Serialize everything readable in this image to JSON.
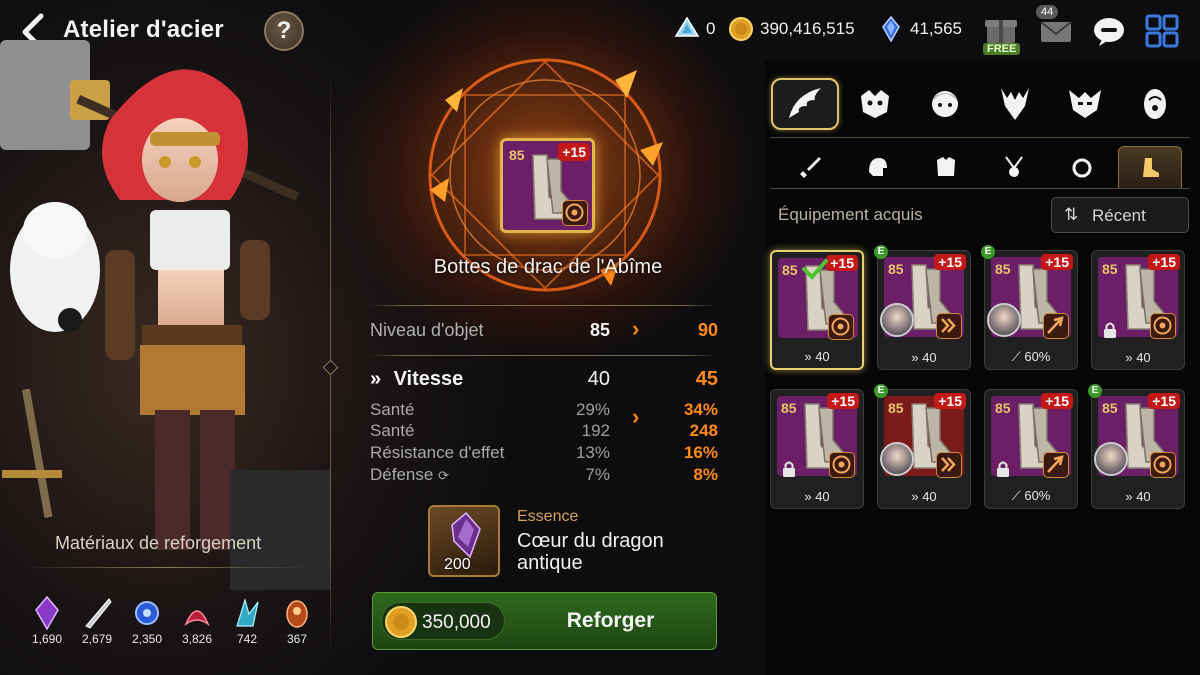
{
  "header": {
    "title": "Atelier d'acier",
    "help_label": "?",
    "currencies": [
      {
        "name": "skystone-icon",
        "value": "0"
      },
      {
        "name": "gold-icon",
        "value": "390,416,515"
      },
      {
        "name": "crystal-icon",
        "value": "41,565"
      }
    ],
    "mail_count": "44",
    "free_label": "FREE"
  },
  "materials": {
    "title": "Matériaux de reforgement",
    "items": [
      {
        "icon": "purple-crystal-icon",
        "count": "1,690"
      },
      {
        "icon": "silver-blade-icon",
        "count": "2,679"
      },
      {
        "icon": "blue-orb-icon",
        "count": "2,350"
      },
      {
        "icon": "red-dragon-scale-icon",
        "count": "3,826"
      },
      {
        "icon": "cyan-claw-icon",
        "count": "742"
      },
      {
        "icon": "ember-stone-icon",
        "count": "367"
      }
    ]
  },
  "item": {
    "level": "85",
    "plus": "+15",
    "name": "Bottes de drac de l'Abîme"
  },
  "stats": {
    "level_label": "Niveau d'objet",
    "level_old": "85",
    "level_new": "90",
    "main": {
      "label": "Vitesse",
      "old": "40",
      "new": "45"
    },
    "subs": [
      {
        "label": "Santé",
        "old": "29%",
        "new": "34%"
      },
      {
        "label": "Santé",
        "old": "192",
        "new": "248"
      },
      {
        "label": "Résistance d'effet",
        "old": "13%",
        "new": "16%"
      },
      {
        "label": "Défense",
        "old": "7%",
        "new": "8%"
      }
    ]
  },
  "essence": {
    "type": "Essence",
    "name": "Cœur du dragon antique",
    "count": "200"
  },
  "reforge": {
    "price": "350,000",
    "label": "Reforger"
  },
  "panel": {
    "equip_title": "Équipement acquis",
    "sort_label": "Récent",
    "cards": [
      {
        "level": "85",
        "plus": "+15",
        "foot": "40",
        "stat": "speed",
        "selected": true,
        "equipped": false,
        "owner": false,
        "locked": false,
        "red": false,
        "emblem": "target"
      },
      {
        "level": "85",
        "plus": "+15",
        "foot": "40",
        "stat": "speed",
        "selected": false,
        "equipped": true,
        "owner": true,
        "locked": false,
        "red": false,
        "emblem": "speed"
      },
      {
        "level": "85",
        "plus": "+15",
        "foot": "60%",
        "stat": "crit",
        "selected": false,
        "equipped": true,
        "owner": true,
        "locked": false,
        "red": false,
        "emblem": "crit"
      },
      {
        "level": "85",
        "plus": "+15",
        "foot": "40",
        "stat": "speed",
        "selected": false,
        "equipped": false,
        "owner": false,
        "locked": true,
        "red": false,
        "emblem": "target"
      },
      {
        "level": "85",
        "plus": "+15",
        "foot": "40",
        "stat": "speed",
        "selected": false,
        "equipped": false,
        "owner": false,
        "locked": true,
        "red": false,
        "emblem": "target"
      },
      {
        "level": "85",
        "plus": "+15",
        "foot": "40",
        "stat": "speed",
        "selected": false,
        "equipped": true,
        "owner": true,
        "locked": false,
        "red": true,
        "emblem": "speed"
      },
      {
        "level": "85",
        "plus": "+15",
        "foot": "60%",
        "stat": "crit",
        "selected": false,
        "equipped": false,
        "owner": false,
        "locked": true,
        "red": false,
        "emblem": "crit"
      },
      {
        "level": "85",
        "plus": "+15",
        "foot": "40",
        "stat": "speed",
        "selected": false,
        "equipped": true,
        "owner": true,
        "locked": false,
        "red": false,
        "emblem": "target"
      }
    ]
  },
  "colors": {
    "accent_orange": "#ff8a17",
    "gold_border": "#e2b54a",
    "button_green": "#2f6a1e"
  }
}
